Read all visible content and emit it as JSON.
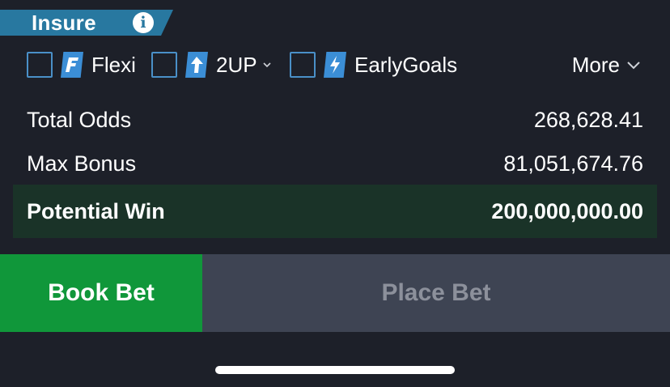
{
  "insure": {
    "label": "Insure",
    "info_glyph": "i"
  },
  "options": {
    "flexi": {
      "label": "Flexi",
      "icon": "flexi-f-icon",
      "checked": false
    },
    "two_up": {
      "label": "2UP",
      "icon": "arrow-up-icon",
      "checked": false
    },
    "early_goals": {
      "label": "EarlyGoals",
      "icon": "lightning-icon",
      "checked": false
    },
    "more_label": "More"
  },
  "summary": {
    "total_odds": {
      "label": "Total Odds",
      "value": "268,628.41"
    },
    "max_bonus": {
      "label": "Max Bonus",
      "value": "81,051,674.76"
    },
    "potential_win": {
      "label": "Potential Win",
      "value": "200,000,000.00"
    }
  },
  "buttons": {
    "book_bet": "Book Bet",
    "place_bet": "Place Bet"
  },
  "colors": {
    "background": "#1d2029",
    "insure_banner": "#2878a0",
    "feature_icon": "#3b8ed6",
    "checkbox_border": "#4a90c8",
    "potential_win_bg": "#1a3328",
    "book_bet": "#10973a",
    "place_bet": "#3e4453",
    "place_bet_text": "#8c909b"
  }
}
